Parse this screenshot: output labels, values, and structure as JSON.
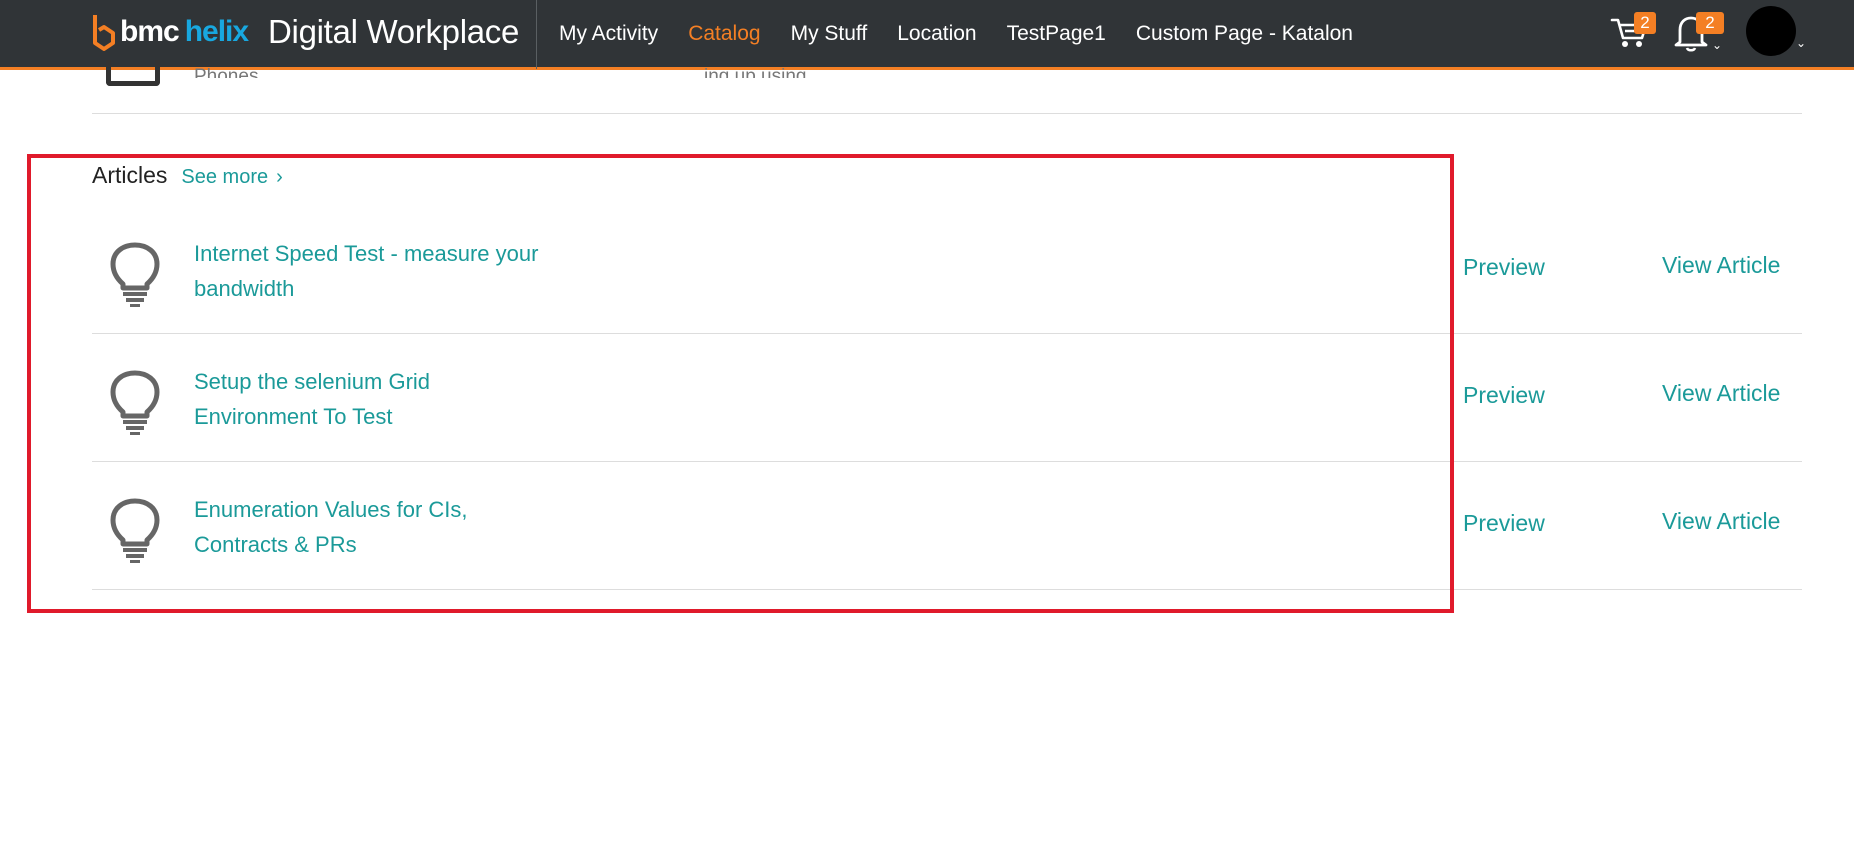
{
  "brand": {
    "bmc": "bmc",
    "helix": "helix",
    "app_title": "Digital Workplace"
  },
  "nav": [
    {
      "label": "My Activity",
      "active": false
    },
    {
      "label": "Catalog",
      "active": true
    },
    {
      "label": "My Stuff",
      "active": false
    },
    {
      "label": "Location",
      "active": false
    },
    {
      "label": "TestPage1",
      "active": false
    },
    {
      "label": "Custom Page - Katalon",
      "active": false
    }
  ],
  "header_icons": {
    "cart_count": "2",
    "notifications_count": "2"
  },
  "previous_section": {
    "row_text": "Phones",
    "row_text2": "ing up using"
  },
  "articles": {
    "title": "Articles",
    "see_more": "See more",
    "items": [
      {
        "title": "Internet Speed Test - measure your bandwidth",
        "preview": "Preview",
        "view": "View Article"
      },
      {
        "title": "Setup the selenium Grid Environment To Test",
        "preview": "Preview",
        "view": "View Article"
      },
      {
        "title": "Enumeration Values for CIs, Contracts & PRs",
        "preview": "Preview",
        "view": "View Article"
      }
    ]
  },
  "colors": {
    "accent": "#f47f24",
    "link": "#1b9a99",
    "topbar": "#303437",
    "highlight": "#e01a2b"
  }
}
